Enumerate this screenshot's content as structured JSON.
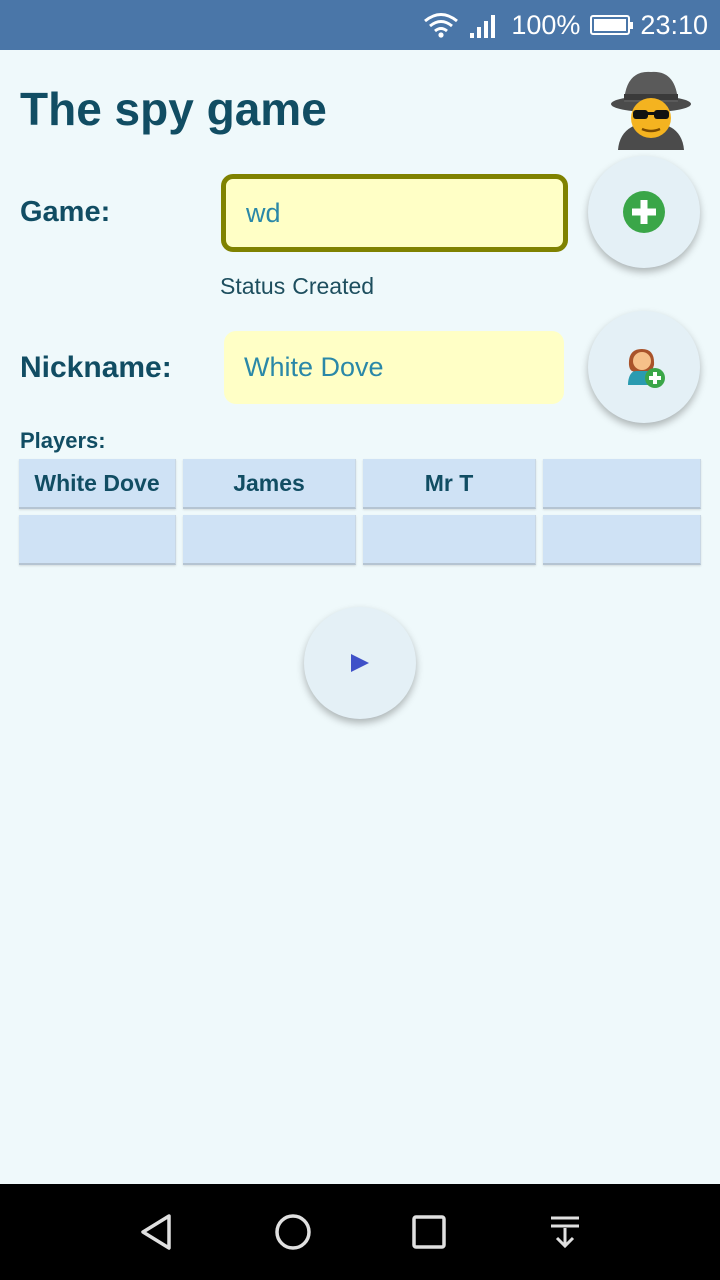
{
  "status_bar": {
    "battery": "100%",
    "time": "23:10",
    "battery_level": 1.0,
    "icons": [
      "wifi-icon",
      "signal-icon",
      "battery-icon"
    ]
  },
  "header": {
    "title": "The spy game",
    "logo_icon": "spy-icon"
  },
  "game": {
    "label": "Game:",
    "value": "wd",
    "create_icon": "add-circle-icon",
    "status_label": "Status",
    "status_value": "Created"
  },
  "nickname": {
    "label": "Nickname:",
    "value": "White Dove",
    "join_icon": "add-person-icon"
  },
  "players": {
    "label": "Players:",
    "rows": [
      [
        "White Dove",
        "James",
        "Mr T",
        ""
      ],
      [
        "",
        "",
        "",
        ""
      ]
    ]
  },
  "play_icon": "play-icon",
  "colors": {
    "accent": "#114d63",
    "status_bar": "#4a76a8",
    "background": "#eff9fb",
    "input_bg": "#ffffc6",
    "input_focus_border": "#7f8200",
    "cell_bg": "#cfe2f5",
    "add_green": "#3aa648",
    "play_blue": "#3f51c8"
  },
  "nav_bar": {
    "icons": [
      "back-icon",
      "home-icon",
      "recents-icon",
      "notifications-pull-icon"
    ]
  }
}
